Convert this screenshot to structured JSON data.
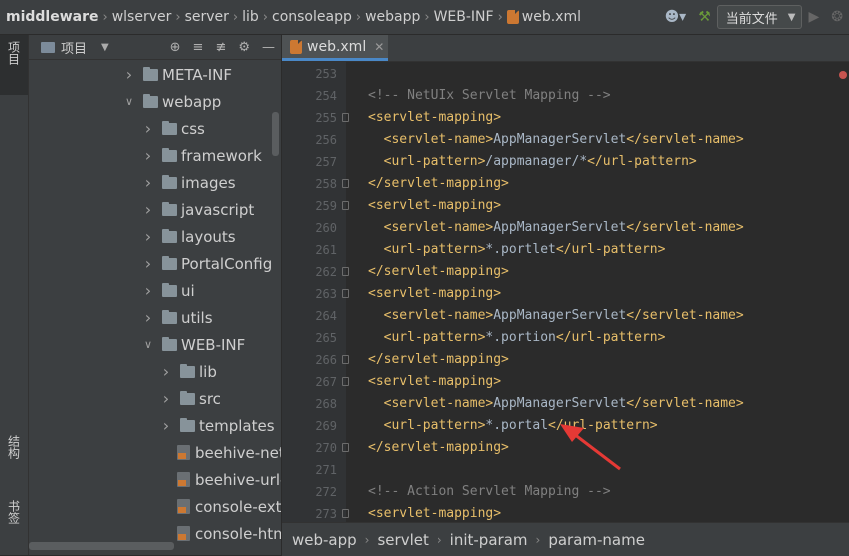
{
  "breadcrumb": [
    "middleware",
    "wlserver",
    "server",
    "lib",
    "consoleapp",
    "webapp",
    "WEB-INF",
    "web.xml"
  ],
  "toolbar": {
    "user_icon": "user-icon",
    "build_icon": "hammer-icon",
    "config_label": "当前文件",
    "run_icon": "run-icon",
    "debug_icon": "debug-icon"
  },
  "left_strip": {
    "project_tab": "项目",
    "structure_tab": "结构",
    "bookmarks_tab": "书签"
  },
  "project_panel": {
    "title": "项目",
    "tree": [
      {
        "label": "META-INF",
        "type": "folder",
        "expanded": false
      },
      {
        "label": "webapp",
        "type": "folder",
        "expanded": true
      },
      {
        "label": "css",
        "type": "folder",
        "expanded": false
      },
      {
        "label": "framework",
        "type": "folder",
        "expanded": false
      },
      {
        "label": "images",
        "type": "folder",
        "expanded": false
      },
      {
        "label": "javascript",
        "type": "folder",
        "expanded": false
      },
      {
        "label": "layouts",
        "type": "folder",
        "expanded": false
      },
      {
        "label": "PortalConfig",
        "type": "folder",
        "expanded": false
      },
      {
        "label": "ui",
        "type": "folder",
        "expanded": false
      },
      {
        "label": "utils",
        "type": "folder",
        "expanded": false
      },
      {
        "label": "WEB-INF",
        "type": "folder",
        "expanded": true
      },
      {
        "label": "lib",
        "type": "folder",
        "expanded": false
      },
      {
        "label": "src",
        "type": "folder",
        "expanded": false
      },
      {
        "label": "templates",
        "type": "folder",
        "expanded": false
      },
      {
        "label": "beehive-net",
        "type": "xml"
      },
      {
        "label": "beehive-url-",
        "type": "xml"
      },
      {
        "label": "console-exte",
        "type": "xml"
      },
      {
        "label": "console-htm",
        "type": "xml"
      }
    ]
  },
  "editor": {
    "tab_label": "web.xml",
    "lines": [
      {
        "n": "253",
        "text": ""
      },
      {
        "n": "254",
        "text": "<!-- NetUIx Servlet Mapping -->"
      },
      {
        "n": "255",
        "text": "<servlet-mapping>"
      },
      {
        "n": "256",
        "text": "  <servlet-name>AppManagerServlet</servlet-name>"
      },
      {
        "n": "257",
        "text": "  <url-pattern>/appmanager/*</url-pattern>"
      },
      {
        "n": "258",
        "text": "</servlet-mapping>"
      },
      {
        "n": "259",
        "text": "<servlet-mapping>"
      },
      {
        "n": "260",
        "text": "  <servlet-name>AppManagerServlet</servlet-name>"
      },
      {
        "n": "261",
        "text": "  <url-pattern>*.portlet</url-pattern>"
      },
      {
        "n": "262",
        "text": "</servlet-mapping>"
      },
      {
        "n": "263",
        "text": "<servlet-mapping>"
      },
      {
        "n": "264",
        "text": "  <servlet-name>AppManagerServlet</servlet-name>"
      },
      {
        "n": "265",
        "text": "  <url-pattern>*.portion</url-pattern>"
      },
      {
        "n": "266",
        "text": "</servlet-mapping>"
      },
      {
        "n": "267",
        "text": "<servlet-mapping>"
      },
      {
        "n": "268",
        "text": "  <servlet-name>AppManagerServlet</servlet-name>"
      },
      {
        "n": "269",
        "text": "  <url-pattern>*.portal</url-pattern>"
      },
      {
        "n": "270",
        "text": "</servlet-mapping>"
      },
      {
        "n": "271",
        "text": ""
      },
      {
        "n": "272",
        "text": "<!-- Action Servlet Mapping -->"
      },
      {
        "n": "273",
        "text": "<servlet-mapping>"
      }
    ]
  },
  "status_path": [
    "web-app",
    "servlet",
    "init-param",
    "param-name"
  ],
  "colors": {
    "accent": "#4a88c7",
    "tag": "#e8bf6a",
    "comment": "#808080",
    "annotation_arrow": "#e53935"
  }
}
